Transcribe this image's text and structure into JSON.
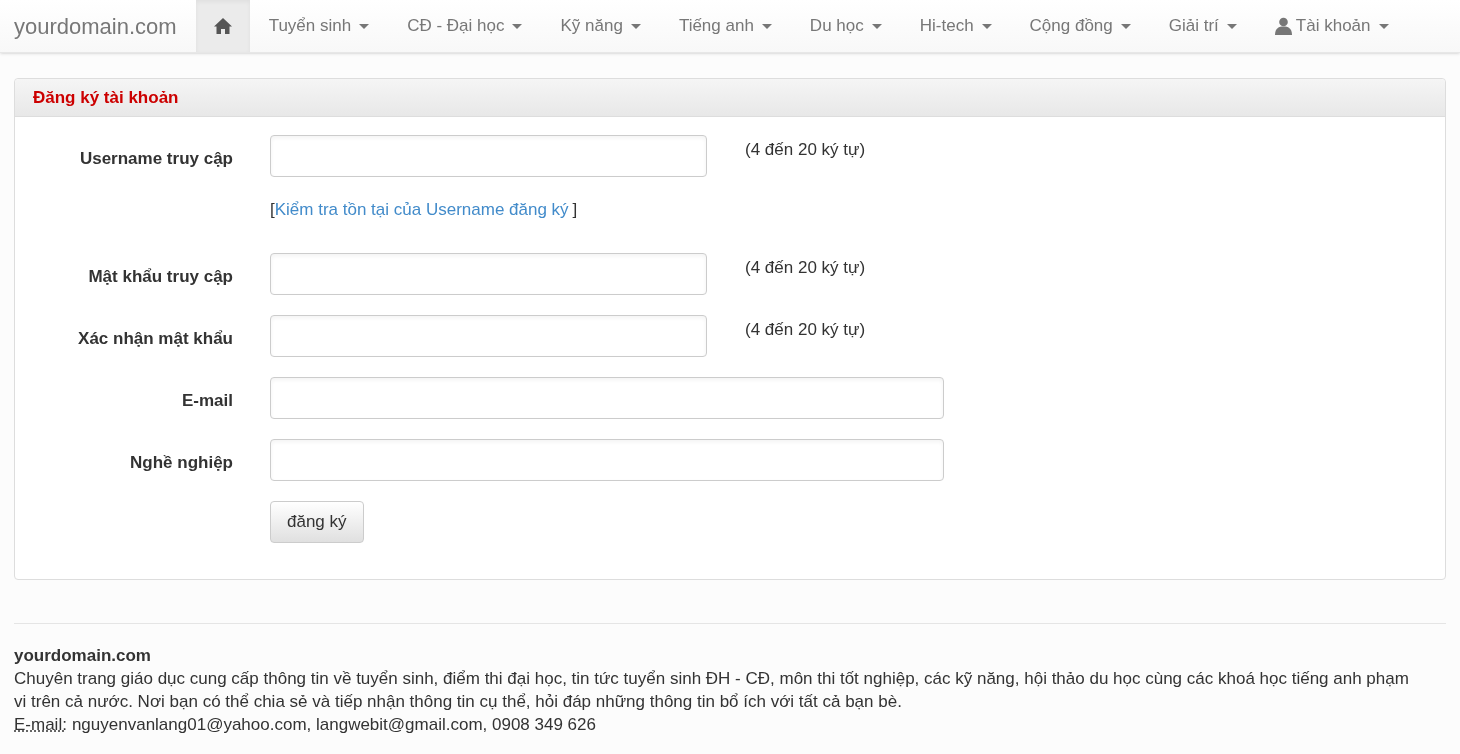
{
  "navbar": {
    "brand": "yourdomain.com",
    "items": [
      {
        "kind": "home",
        "selected": true
      },
      {
        "kind": "menu",
        "label": "Tuyển sinh",
        "selected": false
      },
      {
        "kind": "menu",
        "label": "CĐ - Đại học",
        "selected": false
      },
      {
        "kind": "menu",
        "label": "Kỹ năng",
        "selected": false
      },
      {
        "kind": "menu",
        "label": "Tiếng anh",
        "selected": false
      },
      {
        "kind": "menu",
        "label": "Du học",
        "selected": false
      },
      {
        "kind": "menu",
        "label": "Hi-tech",
        "selected": false
      },
      {
        "kind": "menu",
        "label": "Cộng đồng",
        "selected": false
      },
      {
        "kind": "menu",
        "label": "Giải trí",
        "selected": false
      },
      {
        "kind": "account",
        "label": "Tài khoản",
        "selected": false
      }
    ]
  },
  "panel": {
    "title": "Đăng ký tài khoản",
    "fields": [
      {
        "label": "Username truy cập",
        "hint": "(4 đến 20 ký tự)",
        "link": {
          "open": "[",
          "text": "Kiểm tra tồn tại của Username đăng ký",
          "close": "]"
        }
      },
      {
        "label": "Mật khẩu truy cập",
        "hint": "(4 đến 20 ký tự)"
      },
      {
        "label": "Xác nhận mật khẩu",
        "hint": "(4 đến 20 ký tự)"
      },
      {
        "label": "E-mail"
      },
      {
        "label": "Nghề nghiệp"
      }
    ],
    "submit": "đăng ký"
  },
  "footer": {
    "title": "yourdomain.com",
    "description": "Chuyên trang giáo dục cung cấp thông tin về tuyển sinh, điểm thi đại học, tin tức tuyển sinh ĐH - CĐ, môn thi tốt nghiệp, các kỹ năng, hội thảo du học cùng các khoá học tiếng anh phạm vi trên cả nước. Nơi bạn có thể chia sẻ và tiếp nhận thông tin cụ thể, hỏi đáp những thông tin bổ ích với tất cả bạn bè.",
    "contact_label": "E-mail:",
    "contact": "nguyenvanlang01@yahoo.com, langwebit@gmail.com, 0908 349 626"
  }
}
